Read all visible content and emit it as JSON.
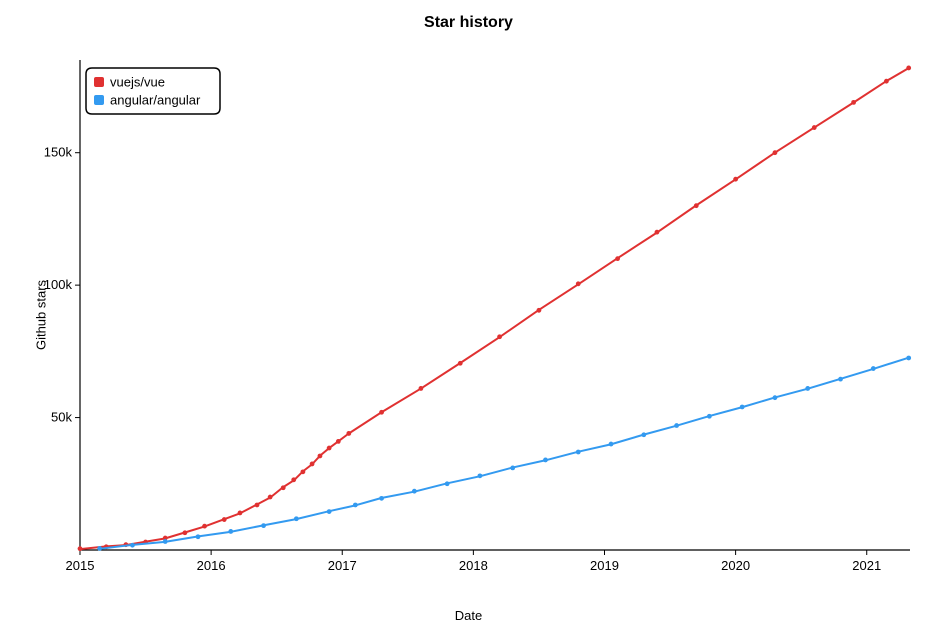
{
  "chart_data": {
    "type": "line",
    "title": "Star history",
    "xlabel": "Date",
    "ylabel": "Github stars",
    "xlim": [
      2015,
      2021.33
    ],
    "ylim": [
      0,
      185000
    ],
    "xticks": [
      2015,
      2016,
      2017,
      2018,
      2019,
      2020,
      2021
    ],
    "xtick_labels": [
      "2015",
      "2016",
      "2017",
      "2018",
      "2019",
      "2020",
      "2021"
    ],
    "yticks": [
      50000,
      100000,
      150000
    ],
    "ytick_labels": [
      "50k",
      "100k",
      "150k"
    ],
    "legend": {
      "position": "top-left"
    },
    "series": [
      {
        "name": "vuejs/vue",
        "color": "#e03131",
        "x": [
          2015.0,
          2015.2,
          2015.35,
          2015.5,
          2015.65,
          2015.8,
          2015.95,
          2016.1,
          2016.22,
          2016.35,
          2016.45,
          2016.55,
          2016.63,
          2016.7,
          2016.77,
          2016.83,
          2016.9,
          2016.97,
          2017.05,
          2017.3,
          2017.6,
          2017.9,
          2018.2,
          2018.5,
          2018.8,
          2019.1,
          2019.4,
          2019.7,
          2020.0,
          2020.3,
          2020.6,
          2020.9,
          2021.15,
          2021.32
        ],
        "y": [
          500,
          1200,
          2000,
          3000,
          4500,
          6500,
          9000,
          11500,
          14000,
          17000,
          20000,
          23500,
          26500,
          29500,
          32500,
          35500,
          38500,
          41000,
          44000,
          52000,
          61000,
          70500,
          80500,
          90500,
          100500,
          110000,
          120000,
          130000,
          140000,
          150000,
          159500,
          169000,
          177000,
          182000
        ]
      },
      {
        "name": "angular/angular",
        "color": "#339af0",
        "x": [
          2015.15,
          2015.4,
          2015.65,
          2015.9,
          2016.15,
          2016.4,
          2016.65,
          2016.9,
          2017.1,
          2017.3,
          2017.55,
          2017.8,
          2018.05,
          2018.3,
          2018.55,
          2018.8,
          2019.05,
          2019.3,
          2019.55,
          2019.8,
          2020.05,
          2020.3,
          2020.55,
          2020.8,
          2021.05,
          2021.32
        ],
        "y": [
          600,
          1800,
          3200,
          5000,
          7000,
          9200,
          11800,
          14500,
          17000,
          19500,
          22200,
          25000,
          28000,
          31000,
          34000,
          37000,
          40000,
          43500,
          47000,
          50500,
          54000,
          57500,
          61000,
          64500,
          68500,
          72500
        ]
      }
    ]
  }
}
